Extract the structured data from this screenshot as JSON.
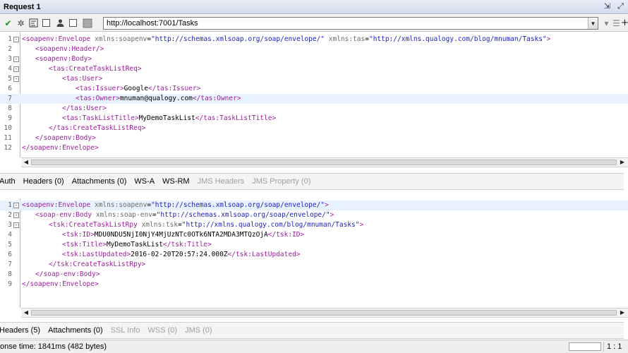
{
  "window": {
    "title": "Request 1"
  },
  "toolbar": {
    "url": "http://localhost:7001/Tasks"
  },
  "request_editor": {
    "lines": [
      {
        "n": "1",
        "fold": "-",
        "indent": 0,
        "tokens": [
          [
            "tg",
            "<"
          ],
          [
            "tn",
            "soapenv:Envelope"
          ],
          [
            "tx",
            " "
          ],
          [
            "an",
            "xmlns:soapenv"
          ],
          [
            "tx",
            "="
          ],
          [
            "av",
            "\"http://schemas.xmlsoap.org/soap/envelope/\""
          ],
          [
            "tx",
            " "
          ],
          [
            "an",
            "xmlns:tas"
          ],
          [
            "tx",
            "="
          ],
          [
            "av",
            "\"http://xmlns.qualogy.com/blog/mnuman/Tasks\""
          ],
          [
            "tg",
            ">"
          ]
        ]
      },
      {
        "n": "2",
        "fold": "",
        "indent": 1,
        "tokens": [
          [
            "tg",
            "<"
          ],
          [
            "tn",
            "soapenv:Header"
          ],
          [
            "tg",
            "/>"
          ]
        ]
      },
      {
        "n": "3",
        "fold": "-",
        "indent": 1,
        "tokens": [
          [
            "tg",
            "<"
          ],
          [
            "tn",
            "soapenv:Body"
          ],
          [
            "tg",
            ">"
          ]
        ]
      },
      {
        "n": "4",
        "fold": "-",
        "indent": 2,
        "tokens": [
          [
            "tg",
            "<"
          ],
          [
            "tn",
            "tas:CreateTaskListReq"
          ],
          [
            "tg",
            ">"
          ]
        ]
      },
      {
        "n": "5",
        "fold": "-",
        "indent": 3,
        "tokens": [
          [
            "tg",
            "<"
          ],
          [
            "tn",
            "tas:User"
          ],
          [
            "tg",
            ">"
          ]
        ]
      },
      {
        "n": "6",
        "fold": "",
        "indent": 4,
        "tokens": [
          [
            "tg",
            "<"
          ],
          [
            "tn",
            "tas:Issuer"
          ],
          [
            "tg",
            ">"
          ],
          [
            "tx",
            "Google"
          ],
          [
            "tg",
            "</"
          ],
          [
            "tn",
            "tas:Issuer"
          ],
          [
            "tg",
            ">"
          ]
        ]
      },
      {
        "n": "7",
        "fold": "",
        "indent": 4,
        "hl": true,
        "tokens": [
          [
            "tg",
            "<"
          ],
          [
            "tn",
            "tas:Owner"
          ],
          [
            "tg",
            ">"
          ],
          [
            "tx",
            "mnuman@qualogy.com"
          ],
          [
            "tg",
            "</"
          ],
          [
            "tn",
            "tas:Owner"
          ],
          [
            "tg",
            ">"
          ]
        ]
      },
      {
        "n": "8",
        "fold": "",
        "indent": 3,
        "tokens": [
          [
            "tg",
            "</"
          ],
          [
            "tn",
            "tas:User"
          ],
          [
            "tg",
            ">"
          ]
        ]
      },
      {
        "n": "9",
        "fold": "",
        "indent": 3,
        "tokens": [
          [
            "tg",
            "<"
          ],
          [
            "tn",
            "tas:TaskListTitle"
          ],
          [
            "tg",
            ">"
          ],
          [
            "tx",
            "MyDemoTaskList"
          ],
          [
            "tg",
            "</"
          ],
          [
            "tn",
            "tas:TaskListTitle"
          ],
          [
            "tg",
            ">"
          ]
        ]
      },
      {
        "n": "10",
        "fold": "",
        "indent": 2,
        "tokens": [
          [
            "tg",
            "</"
          ],
          [
            "tn",
            "tas:CreateTaskListReq"
          ],
          [
            "tg",
            ">"
          ]
        ]
      },
      {
        "n": "11",
        "fold": "",
        "indent": 1,
        "tokens": [
          [
            "tg",
            "</"
          ],
          [
            "tn",
            "soapenv:Body"
          ],
          [
            "tg",
            ">"
          ]
        ]
      },
      {
        "n": "12",
        "fold": "",
        "indent": 0,
        "tokens": [
          [
            "tg",
            "</"
          ],
          [
            "tn",
            "soapenv:Envelope"
          ],
          [
            "tg",
            ">"
          ]
        ]
      }
    ]
  },
  "request_tabs": [
    {
      "label": "Auth",
      "disabled": false
    },
    {
      "label": "Headers (0)",
      "disabled": false
    },
    {
      "label": "Attachments (0)",
      "disabled": false
    },
    {
      "label": "WS-A",
      "disabled": false
    },
    {
      "label": "WS-RM",
      "disabled": false
    },
    {
      "label": "JMS Headers",
      "disabled": true
    },
    {
      "label": "JMS Property (0)",
      "disabled": true
    }
  ],
  "response_editor": {
    "lines": [
      {
        "n": "1",
        "fold": "-",
        "indent": 0,
        "hl": true,
        "tokens": [
          [
            "tg",
            "<"
          ],
          [
            "tn",
            "soapenv:Envelope"
          ],
          [
            "tx",
            " "
          ],
          [
            "an",
            "xmlns:soapenv"
          ],
          [
            "tx",
            "="
          ],
          [
            "av",
            "\"http://schemas.xmlsoap.org/soap/envelope/\""
          ],
          [
            "tg",
            ">"
          ]
        ]
      },
      {
        "n": "2",
        "fold": "-",
        "indent": 1,
        "tokens": [
          [
            "tg",
            "<"
          ],
          [
            "tn",
            "soap-env:Body"
          ],
          [
            "tx",
            " "
          ],
          [
            "an",
            "xmlns:soap-env"
          ],
          [
            "tx",
            "="
          ],
          [
            "av",
            "\"http://schemas.xmlsoap.org/soap/envelope/\""
          ],
          [
            "tg",
            ">"
          ]
        ]
      },
      {
        "n": "3",
        "fold": "-",
        "indent": 2,
        "tokens": [
          [
            "tg",
            "<"
          ],
          [
            "tn",
            "tsk:CreateTaskListRpy"
          ],
          [
            "tx",
            " "
          ],
          [
            "an",
            "xmlns:tsk"
          ],
          [
            "tx",
            "="
          ],
          [
            "av",
            "\"http://xmlns.qualogy.com/blog/mnuman/Tasks\""
          ],
          [
            "tg",
            ">"
          ]
        ]
      },
      {
        "n": "4",
        "fold": "",
        "indent": 3,
        "tokens": [
          [
            "tg",
            "<"
          ],
          [
            "tn",
            "tsk:ID"
          ],
          [
            "tg",
            ">"
          ],
          [
            "tx",
            "MDU0NDU5NjI0NjY4MjUzNTc0OTk6NTA2MDA3MTQzOjA"
          ],
          [
            "tg",
            "</"
          ],
          [
            "tn",
            "tsk:ID"
          ],
          [
            "tg",
            ">"
          ]
        ]
      },
      {
        "n": "5",
        "fold": "",
        "indent": 3,
        "tokens": [
          [
            "tg",
            "<"
          ],
          [
            "tn",
            "tsk:Title"
          ],
          [
            "tg",
            ">"
          ],
          [
            "tx",
            "MyDemoTaskList"
          ],
          [
            "tg",
            "</"
          ],
          [
            "tn",
            "tsk:Title"
          ],
          [
            "tg",
            ">"
          ]
        ]
      },
      {
        "n": "6",
        "fold": "",
        "indent": 3,
        "tokens": [
          [
            "tg",
            "<"
          ],
          [
            "tn",
            "tsk:LastUpdated"
          ],
          [
            "tg",
            ">"
          ],
          [
            "tx",
            "2016-02-20T20:57:24.000Z"
          ],
          [
            "tg",
            "</"
          ],
          [
            "tn",
            "tsk:LastUpdated"
          ],
          [
            "tg",
            ">"
          ]
        ]
      },
      {
        "n": "7",
        "fold": "",
        "indent": 2,
        "tokens": [
          [
            "tg",
            "</"
          ],
          [
            "tn",
            "tsk:CreateTaskListRpy"
          ],
          [
            "tg",
            ">"
          ]
        ]
      },
      {
        "n": "8",
        "fold": "",
        "indent": 1,
        "tokens": [
          [
            "tg",
            "</"
          ],
          [
            "tn",
            "soap-env:Body"
          ],
          [
            "tg",
            ">"
          ]
        ]
      },
      {
        "n": "9",
        "fold": "",
        "indent": 0,
        "tokens": [
          [
            "tg",
            "</"
          ],
          [
            "tn",
            "soapenv:Envelope"
          ],
          [
            "tg",
            ">"
          ]
        ]
      }
    ]
  },
  "response_tabs": [
    {
      "label": "Headers (5)",
      "disabled": false
    },
    {
      "label": "Attachments (0)",
      "disabled": false
    },
    {
      "label": "SSL Info",
      "disabled": true
    },
    {
      "label": "WSS (0)",
      "disabled": true
    },
    {
      "label": "JMS (0)",
      "disabled": true
    }
  ],
  "status": {
    "response_time": "onse time: 1841ms (482 bytes)",
    "position": "1 : 1"
  },
  "icons": {
    "run": "run-icon",
    "add-step": "add-step-icon",
    "create-form": "form-view-icon",
    "stop": "stop-icon",
    "auth": "user-icon",
    "raw": "raw-view-icon",
    "split": "split-view-icon",
    "settings": "settings-icon",
    "colors": {
      "tag": "#9b1f9b",
      "attr_name": "#6a6a6a",
      "attr_value": "#2020c0"
    }
  }
}
